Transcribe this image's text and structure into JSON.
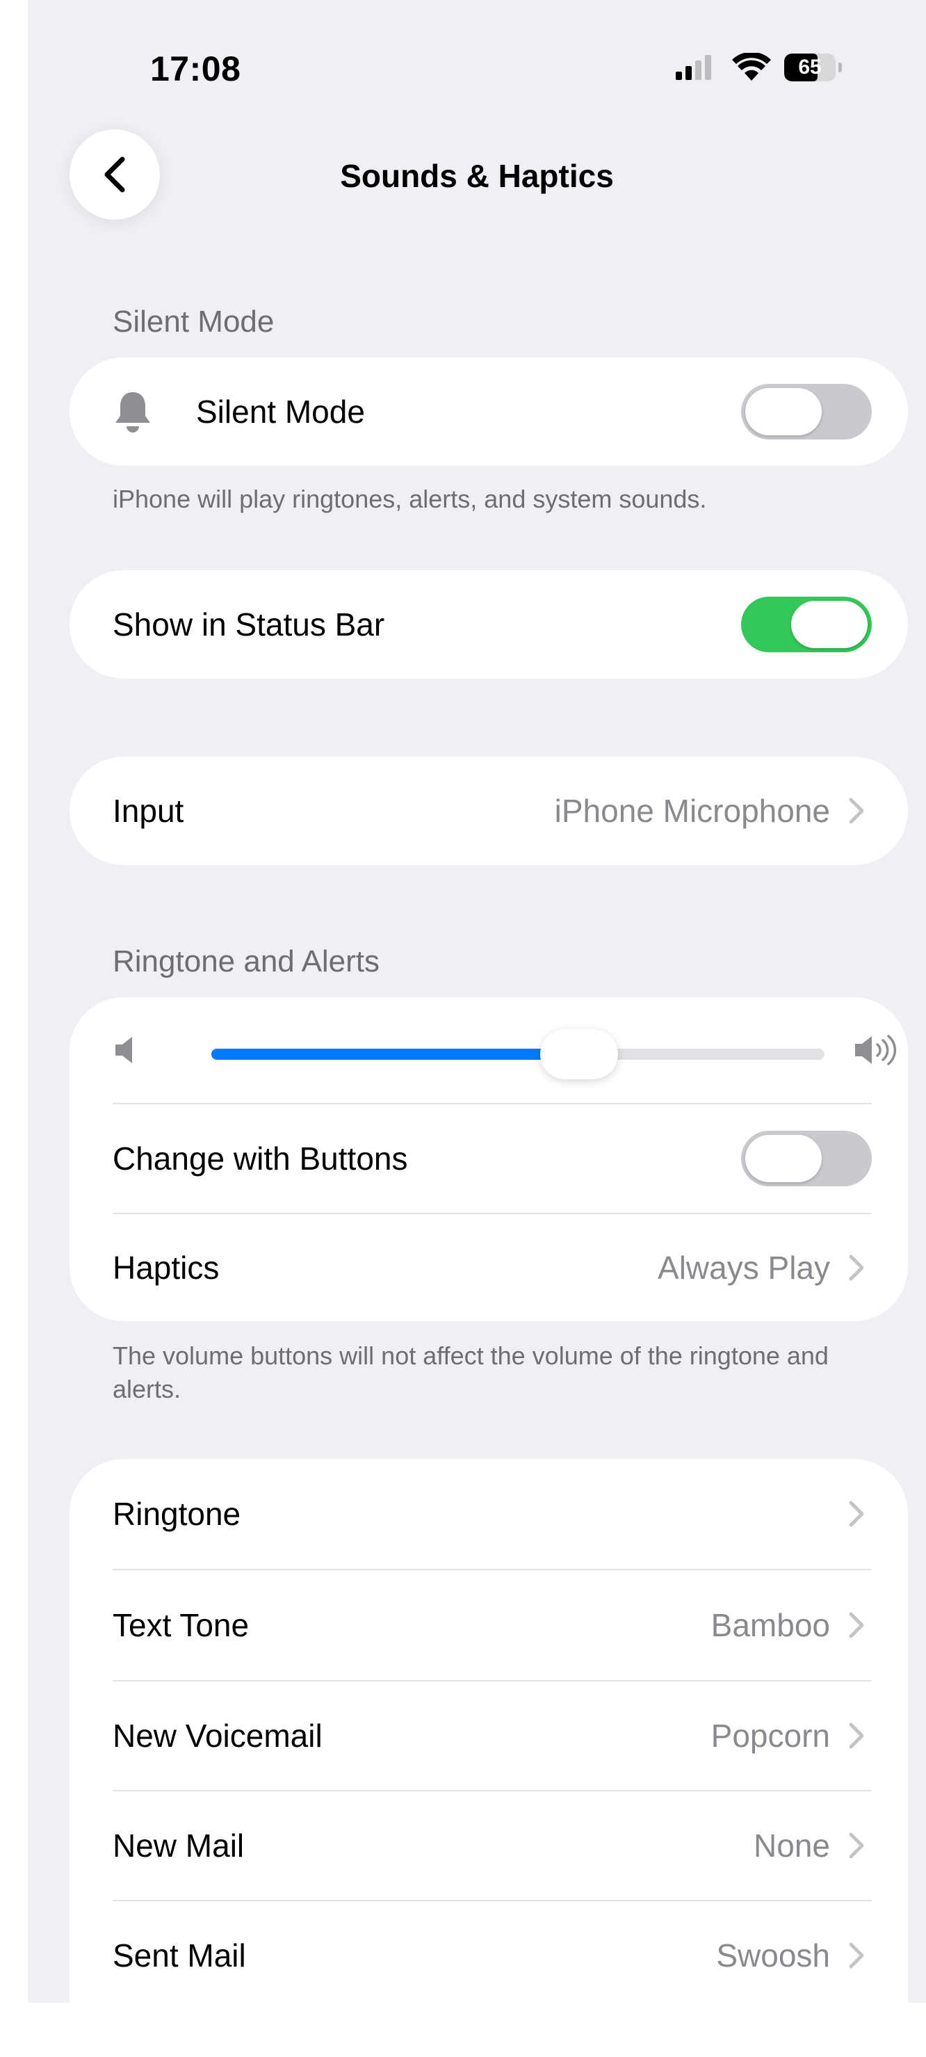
{
  "status_bar": {
    "time": "17:08",
    "battery": "65",
    "battery_level": 0.65
  },
  "nav": {
    "title": "Sounds & Haptics",
    "back_icon": "chevron-left-icon"
  },
  "silent_mode": {
    "header": "Silent Mode",
    "row_label": "Silent Mode",
    "row_icon": "bell-icon",
    "toggle_on": false,
    "footer": "iPhone will play ringtones, alerts, and system sounds."
  },
  "status_bar_option": {
    "label": "Show in Status Bar",
    "toggle_on": true
  },
  "input": {
    "label": "Input",
    "value": "iPhone Microphone"
  },
  "ringtone_alerts": {
    "header": "Ringtone and Alerts",
    "volume_level": 0.6,
    "volume_low_icon": "speaker-low-icon",
    "volume_high_icon": "speaker-high-icon",
    "change_with_buttons_label": "Change with Buttons",
    "change_with_buttons_on": false,
    "haptics_label": "Haptics",
    "haptics_value": "Always Play",
    "footer": "The volume buttons will not affect the volume of the ringtone and alerts."
  },
  "tones": [
    {
      "label": "Ringtone",
      "value": ""
    },
    {
      "label": "Text Tone",
      "value": "Bamboo"
    },
    {
      "label": "New Voicemail",
      "value": "Popcorn"
    },
    {
      "label": "New Mail",
      "value": "None"
    },
    {
      "label": "Sent Mail",
      "value": "Swoosh"
    }
  ],
  "colors": {
    "background": "#efeff4",
    "toggle_on": "#34c759",
    "toggle_off": "#c9c9ce",
    "slider_fill": "#007aff"
  }
}
